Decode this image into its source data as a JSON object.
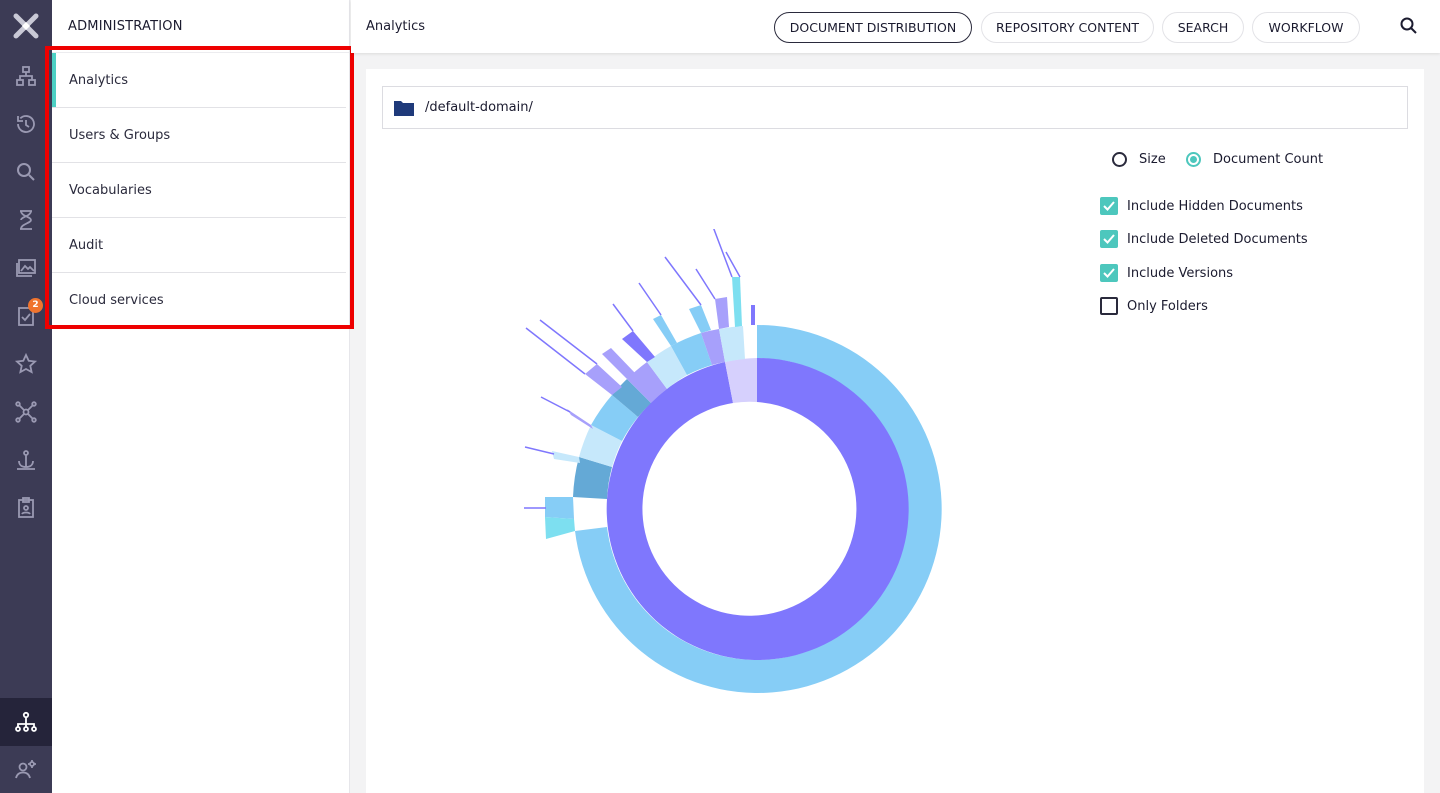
{
  "rail": {
    "icons": [
      "logo-x-icon",
      "hierarchy-icon",
      "history-icon",
      "search-icon",
      "hourglass-icon",
      "gallery-icon",
      "tasks-icon",
      "star-icon",
      "network-icon",
      "anchor-icon",
      "clipboard-user-icon",
      "admin-tree-icon",
      "user-settings-icon"
    ],
    "tasks_badge": "2"
  },
  "admin": {
    "header": "ADMINISTRATION",
    "items": [
      {
        "label": "Analytics"
      },
      {
        "label": "Users & Groups"
      },
      {
        "label": "Vocabularies"
      },
      {
        "label": "Audit"
      },
      {
        "label": "Cloud services"
      }
    ]
  },
  "topbar": {
    "title": "Analytics",
    "tabs": [
      {
        "label": "DOCUMENT DISTRIBUTION"
      },
      {
        "label": "REPOSITORY CONTENT"
      },
      {
        "label": "SEARCH"
      },
      {
        "label": "WORKFLOW"
      }
    ]
  },
  "main": {
    "path": "/default-domain/",
    "options": {
      "radio_size": "Size",
      "radio_count": "Document Count",
      "selected": "Document Count",
      "hidden_docs": "Include Hidden Documents",
      "deleted_docs": "Include Deleted Documents",
      "versions": "Include Versions",
      "only_folders": "Only Folders"
    }
  },
  "colors": {
    "accent": "#4dc7bd",
    "rail": "#3c3b55",
    "ring_inner": "#7f77fd",
    "ring_outer": "#86cdf6",
    "highlight": "#ee0000"
  }
}
